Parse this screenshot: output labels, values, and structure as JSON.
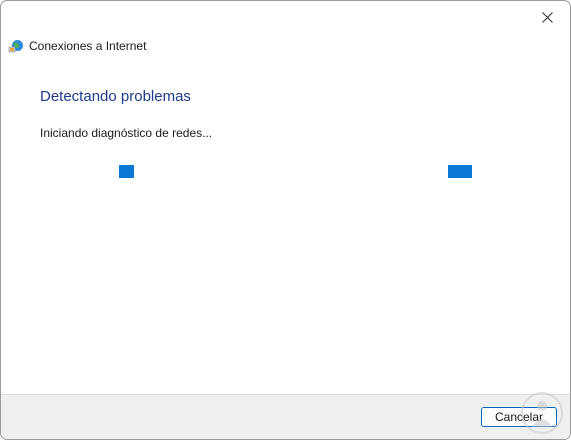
{
  "window": {
    "close_icon": "close-icon"
  },
  "app": {
    "icon": "network-globe-icon",
    "title": "Conexiones a Internet"
  },
  "main": {
    "heading": "Detectando problemas",
    "status": "Iniciando diagnóstico de redes..."
  },
  "footer": {
    "cancel_label": "Cancelar"
  },
  "colors": {
    "heading": "#1c3c8c",
    "accent": "#0a78d4",
    "footer_bg": "#f0f0f0"
  }
}
